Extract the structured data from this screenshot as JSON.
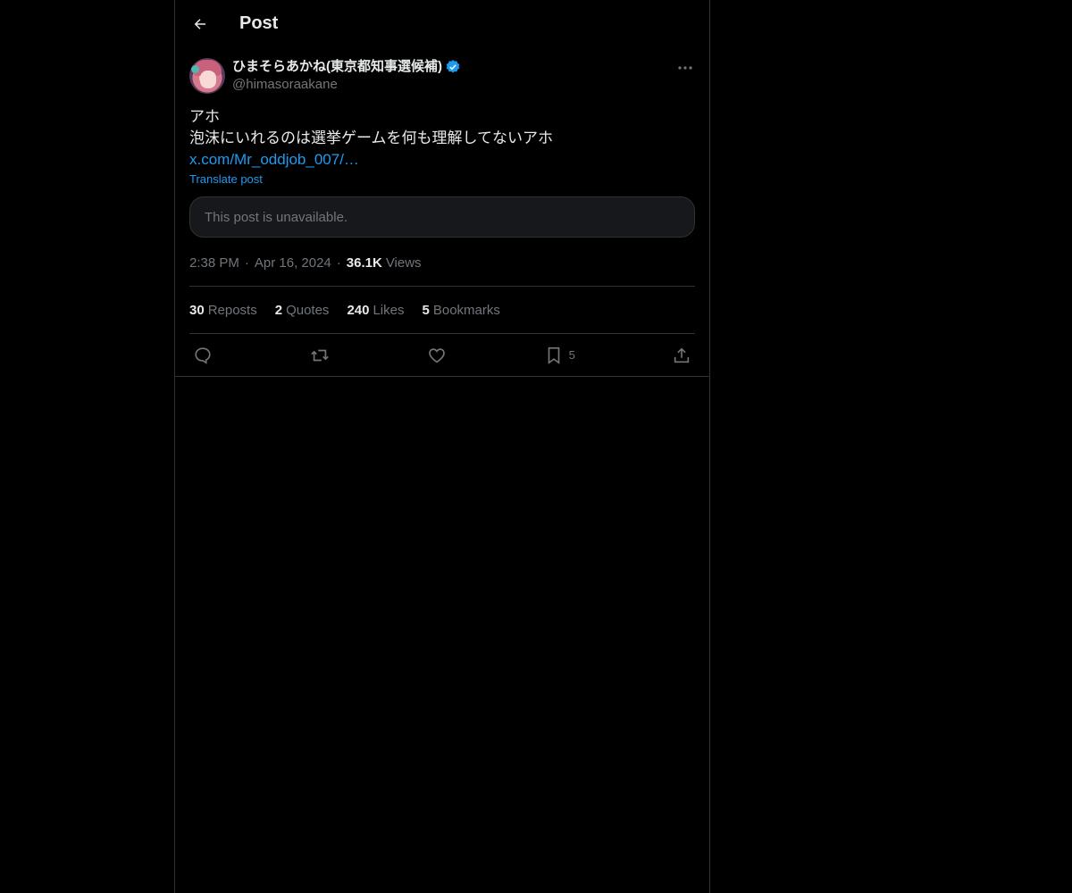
{
  "header": {
    "title": "Post",
    "back_icon": "arrow-left-icon"
  },
  "author": {
    "display_name": "ひまそらあかね(東京都知事選候補)",
    "handle": "@himasoraakane",
    "verified_icon": "verified-badge-icon",
    "verified_color": "#1d9bf0"
  },
  "post": {
    "lines": [
      "アホ",
      "泡沫にいれるのは選挙ゲームを何も理解してないアホ"
    ],
    "link_text": "x.com/Mr_oddjob_007/…",
    "translate_label": "Translate post",
    "quote_unavailable": "This post is unavailable."
  },
  "meta": {
    "time": "2:38 PM",
    "date": "Apr 16, 2024",
    "views_count": "36.1K",
    "views_label": "Views"
  },
  "stats": [
    {
      "count": "30",
      "label": "Reposts"
    },
    {
      "count": "2",
      "label": "Quotes"
    },
    {
      "count": "240",
      "label": "Likes"
    },
    {
      "count": "5",
      "label": "Bookmarks"
    }
  ],
  "actions": {
    "reply_icon": "reply-icon",
    "repost_icon": "repost-icon",
    "like_icon": "heart-icon",
    "bookmark_icon": "bookmark-icon",
    "bookmark_count": "5",
    "share_icon": "share-icon"
  },
  "colors": {
    "background": "#000000",
    "accent": "#1d9bf0",
    "muted": "#71767b",
    "border": "#2f3336"
  }
}
